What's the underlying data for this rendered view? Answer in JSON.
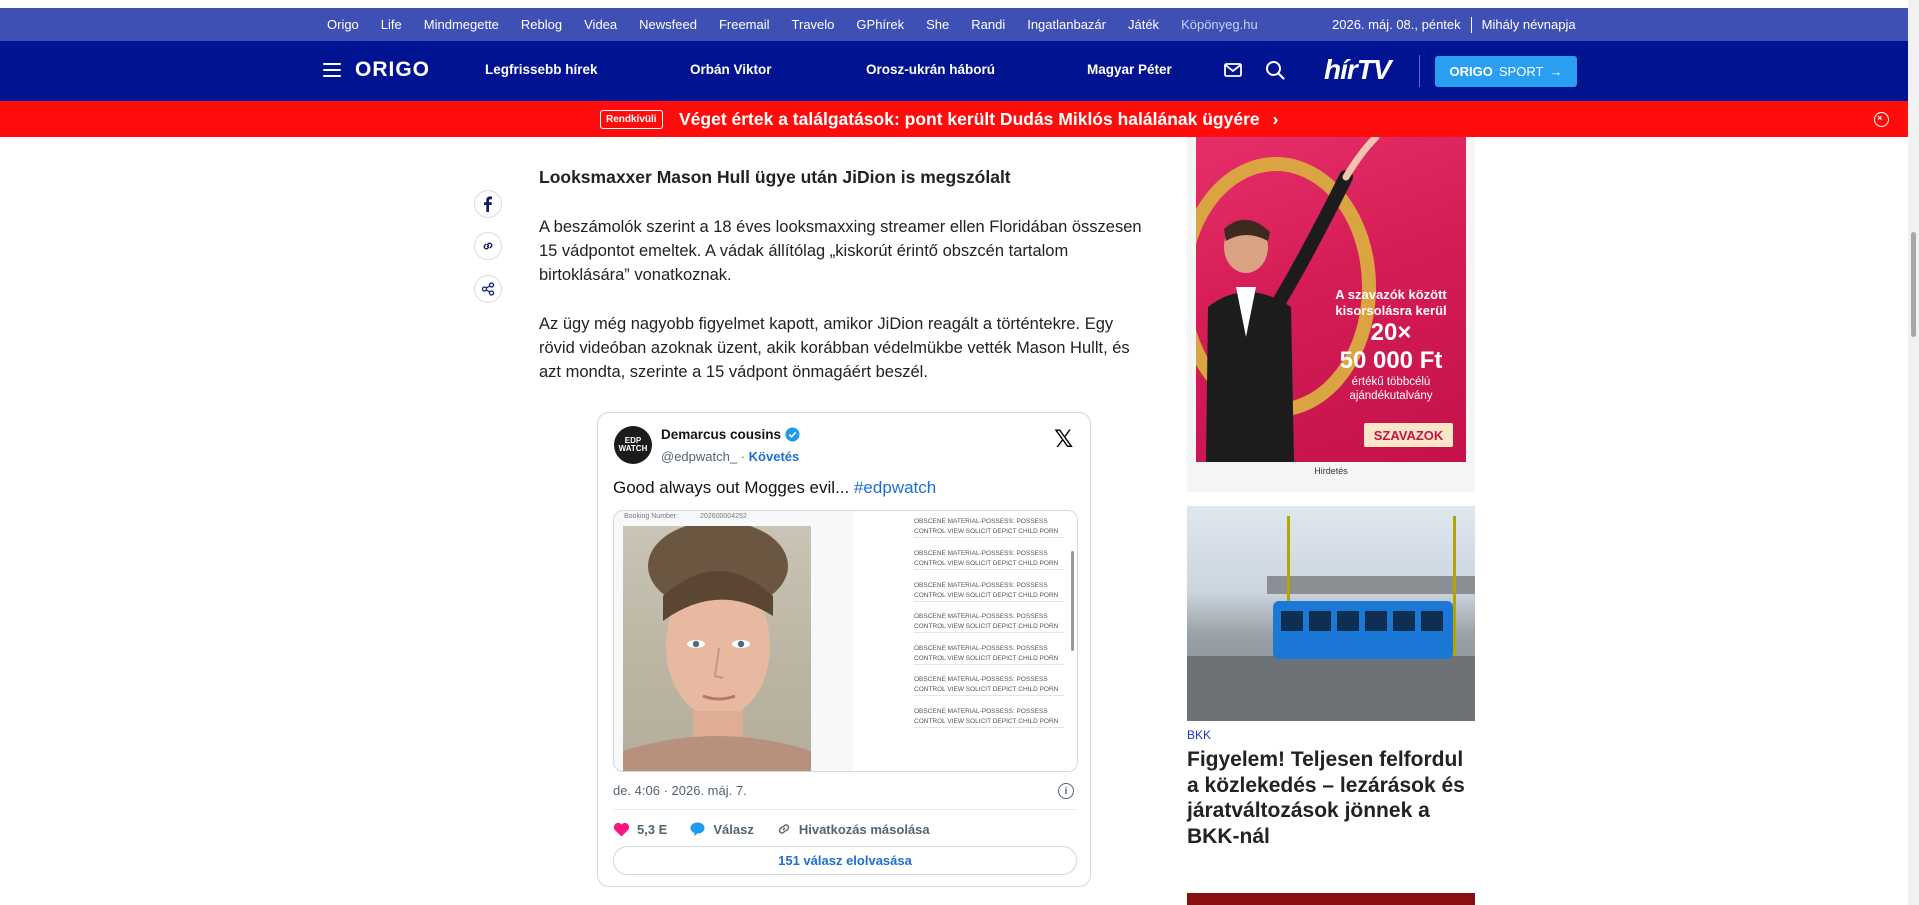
{
  "topbar": {
    "links": [
      "Origo",
      "Life",
      "Mindmegette",
      "Reblog",
      "Videa",
      "Newsfeed",
      "Freemail",
      "Travelo",
      "GPhírek",
      "She",
      "Randi",
      "Ingatlanbazár",
      "Játék",
      "Köpönyeg.hu"
    ],
    "date": "2026. máj. 08., péntek",
    "nameday": "Mihály névnapja"
  },
  "nav": {
    "logo": "ORIGO",
    "items": [
      "Legfrissebb hírek",
      "Orbán Viktor",
      "Orosz-ukrán háború",
      "Magyar Péter"
    ],
    "hirtv": "hírTV",
    "sport_button": {
      "bold": "ORIGO",
      "rest": "SPORT"
    }
  },
  "breaking": {
    "badge": "Rendkívüli",
    "headline": "Véget értek a találgatások: pont került Dudás Miklós halálának ügyére"
  },
  "article": {
    "heading": "Looksmaxxer Mason Hull ügye után JiDion is megszólalt",
    "paragraph1": "A beszámolók szerint a 18 éves looksmaxxing streamer ellen Floridában összesen 15 vádpontot emeltek. A vádak állítólag „kiskorút érintő obszcén tartalom birtoklására” vonatkoznak.",
    "paragraph2": "Az ügy még nagyobb figyelmet kapott, amikor JiDion reagált a történtekre. Egy rövid videóban azoknak üzent, akik korábban védelmükbe vették Mason Hullt, és azt mondta, szerinte a 15 vádpont önmagáért beszél."
  },
  "tweet": {
    "avatar_text": "EDP WATCH",
    "name": "Demarcus cousins",
    "handle": "@edpwatch_ ·",
    "follow": "Követés",
    "text": "Good always out Mogges evil...",
    "hashtag": "#edpwatch",
    "media": {
      "booking_label": "Booking Number:",
      "booking_number": "202600004252",
      "charges": [
        "OBSCENE MATERIAL-POSSESS: POSSESS CONTROL VIEW SOLICIT DEPICT CHILD PORN",
        "OBSCENE MATERIAL-POSSESS: POSSESS CONTROL VIEW SOLICIT DEPICT CHILD PORN",
        "OBSCENE MATERIAL-POSSESS: POSSESS CONTROL VIEW SOLICIT DEPICT CHILD PORN",
        "OBSCENE MATERIAL-POSSESS: POSSESS CONTROL VIEW SOLICIT DEPICT CHILD PORN",
        "OBSCENE MATERIAL-POSSESS: POSSESS CONTROL VIEW SOLICIT DEPICT CHILD PORN",
        "OBSCENE MATERIAL-POSSESS: POSSESS CONTROL VIEW SOLICIT DEPICT CHILD PORN",
        "OBSCENE MATERIAL-POSSESS: POSSESS CONTROL VIEW SOLICIT DEPICT CHILD PORN"
      ]
    },
    "timestamp": "de. 4:06 · 2026. máj. 7.",
    "likes": "5,3 E",
    "reply": "Válasz",
    "copy_link": "Hivatkozás másolása",
    "read_replies": "151 válasz elolvasása"
  },
  "ad": {
    "line1": "A szavazók között kisorsolásra kerül",
    "line2": "20×",
    "line3": "50 000 Ft",
    "line4": "értékű többcélú ajándékutalvány",
    "button": "SZAVAZOK",
    "label": "Hirdetés"
  },
  "sidebar_news": {
    "category": "BKK",
    "title": "Figyelem! Teljesen felfordul a közlekedés – lezárások és járatváltozások jönnek a BKK-nál"
  },
  "colors": {
    "topbar": "#3f50b5",
    "nav": "#001391",
    "breaking": "#ff0d0d",
    "sport": "#2a9ef0",
    "link": "#1d6fd1"
  }
}
